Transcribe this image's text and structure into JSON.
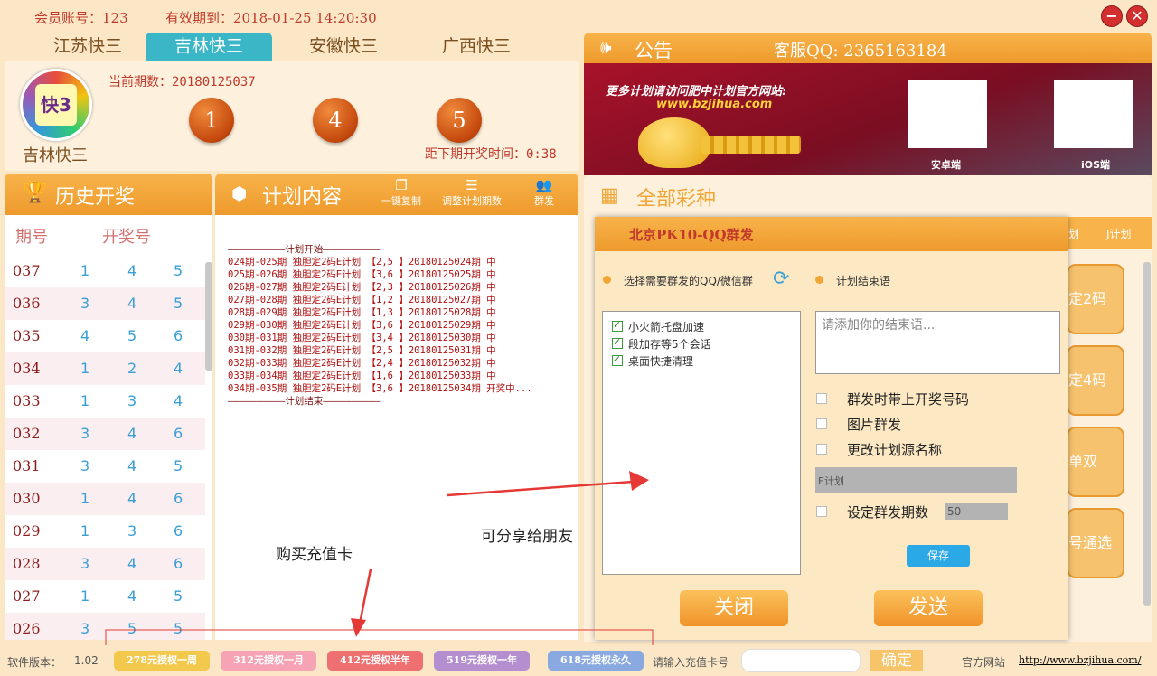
{
  "header": {
    "account_label": "会员账号：123",
    "expire_label": "有效期到：2018-01-25 14:20:30"
  },
  "tabs": [
    "江苏快三",
    "吉林快三",
    "安徽快三",
    "广西快三"
  ],
  "lotto": {
    "logo_text": "快3",
    "name": "吉林快三",
    "current_issue": "当前期数：20180125037",
    "balls": [
      "1",
      "4",
      "5"
    ],
    "countdown": "距下期开奖时间：0:38"
  },
  "notice": {
    "title": "公告",
    "qq": "客服QQ: 2365163184"
  },
  "ad": {
    "headline": "更多计划请访问肥中计划官方网站:",
    "url": "www.bzjihua.com",
    "qr_android": "安卓端",
    "qr_ios": "iOS端"
  },
  "history": {
    "title": "历史开奖",
    "col_issue": "期号",
    "col_numbers": "开奖号",
    "rows": [
      {
        "issue": "037",
        "n": [
          "1",
          "4",
          "5"
        ]
      },
      {
        "issue": "036",
        "n": [
          "3",
          "4",
          "5"
        ]
      },
      {
        "issue": "035",
        "n": [
          "4",
          "5",
          "6"
        ]
      },
      {
        "issue": "034",
        "n": [
          "1",
          "2",
          "4"
        ]
      },
      {
        "issue": "033",
        "n": [
          "1",
          "3",
          "4"
        ]
      },
      {
        "issue": "032",
        "n": [
          "3",
          "4",
          "6"
        ]
      },
      {
        "issue": "031",
        "n": [
          "3",
          "4",
          "5"
        ]
      },
      {
        "issue": "030",
        "n": [
          "1",
          "4",
          "6"
        ]
      },
      {
        "issue": "029",
        "n": [
          "1",
          "3",
          "6"
        ]
      },
      {
        "issue": "028",
        "n": [
          "3",
          "4",
          "6"
        ]
      },
      {
        "issue": "027",
        "n": [
          "1",
          "4",
          "5"
        ]
      },
      {
        "issue": "026",
        "n": [
          "3",
          "5",
          "5"
        ]
      }
    ]
  },
  "plan": {
    "title": "计划内容",
    "tools": [
      "一键复制",
      "调整计划期数",
      "群发"
    ],
    "lines": [
      "——————————计划开始——————————",
      "024期-025期 独胆定2码E计划 【2,5 】20180125024期 中",
      "025期-026期 独胆定2码E计划 【3,6 】20180125025期 中",
      "026期-027期 独胆定2码E计划 【2,3 】20180125026期 中",
      "027期-028期 独胆定2码E计划 【1,2 】20180125027期 中",
      "028期-029期 独胆定2码E计划 【1,3 】20180125028期 中",
      "029期-030期 独胆定2码E计划 【3,6 】20180125029期 中",
      "030期-031期 独胆定2码E计划 【3,4 】20180125030期 中",
      "031期-032期 独胆定2码E计划 【2,5 】20180125031期 中",
      "032期-033期 独胆定2码E计划 【2,4 】20180125032期 中",
      "033期-034期 独胆定2码E计划 【1,6 】20180125033期 中",
      "034期-035期 独胆定2码E计划 【3,6 】20180125034期 开奖中...",
      "——————————计划结束——————————"
    ]
  },
  "games": {
    "title": "全部彩种",
    "side_tab": "J计划",
    "cards": [
      "定2码",
      "定4码",
      "单双",
      "号通选"
    ],
    "side_small": "划"
  },
  "dialog": {
    "title": "北京PK10-QQ群发",
    "group_label": "选择需要群发的QQ/微信群",
    "end_label": "计划结束语",
    "groups": [
      "小火箭托盘加速",
      "段加存等5个会话",
      "桌面快捷清理"
    ],
    "end_placeholder": "请添加你的结束语...",
    "opt1": "群发时带上开奖号码",
    "opt2": "图片群发",
    "opt3": "更改计划源名称",
    "source_name": "E计划",
    "opt4": "设定群发期数",
    "period_value": "50",
    "save": "保存",
    "close": "关闭",
    "send": "发送"
  },
  "annotations": {
    "share": "可分享给朋友",
    "buy": "购买充值卡"
  },
  "footer": {
    "version_label": "软件版本：",
    "version": "1.02",
    "pay": [
      "278元授权一周",
      "312元授权一月",
      "412元授权半年",
      "519元授权一年",
      "618元授权永久"
    ],
    "card_label": "请输入充值卡号",
    "confirm": "确定",
    "site_label": "官方网站",
    "site_url": "http://www.bzjihua.com/"
  },
  "colors": {
    "accent": "#f0a535",
    "teal": "#3bb6c6",
    "pay": [
      "#f2c94c",
      "#f5a3b5",
      "#ef7070",
      "#b48fd0",
      "#8aa9e0"
    ]
  }
}
